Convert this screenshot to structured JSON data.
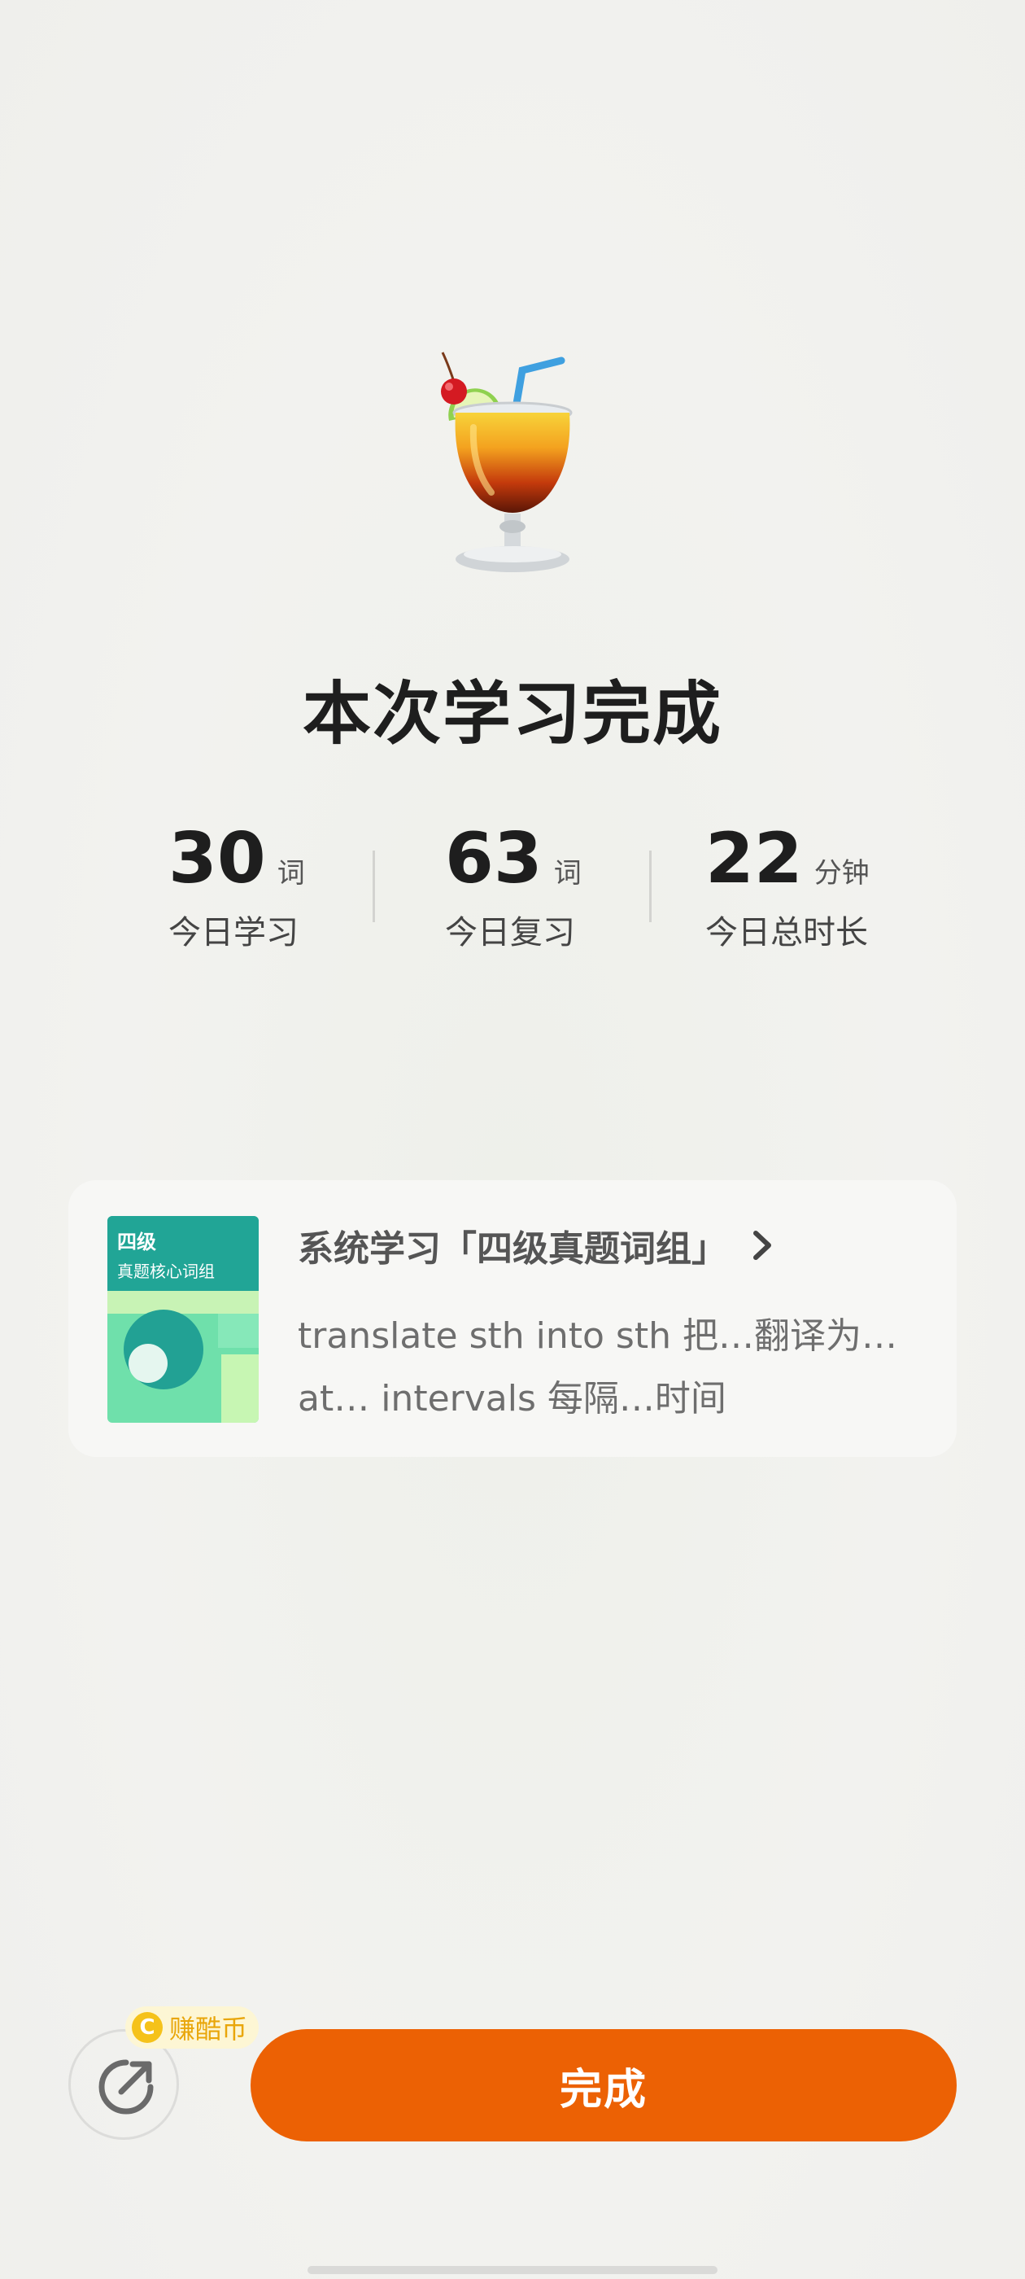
{
  "header": {
    "hero_icon": "tropical-drink-icon",
    "title": "本次学习完成"
  },
  "stats": [
    {
      "value": "30",
      "unit": "词",
      "label": "今日学习"
    },
    {
      "value": "63",
      "unit": "词",
      "label": "今日复习"
    },
    {
      "value": "22",
      "unit": "分钟",
      "label": "今日总时长"
    }
  ],
  "book_card": {
    "cover_title": "四级",
    "cover_subtitle": "真题核心词组",
    "title": "系统学习「四级真题词组」",
    "lines": [
      "translate sth into sth 把…翻译为…",
      "at… intervals 每隔…时间"
    ]
  },
  "actions": {
    "share_icon": "share-arrow-icon",
    "coin_badge_symbol": "C",
    "coin_badge_label": "赚酷币",
    "done_label": "完成"
  },
  "colors": {
    "accent": "#ec6104",
    "cover_primary": "#21a596",
    "coin": "#f5c21a"
  }
}
